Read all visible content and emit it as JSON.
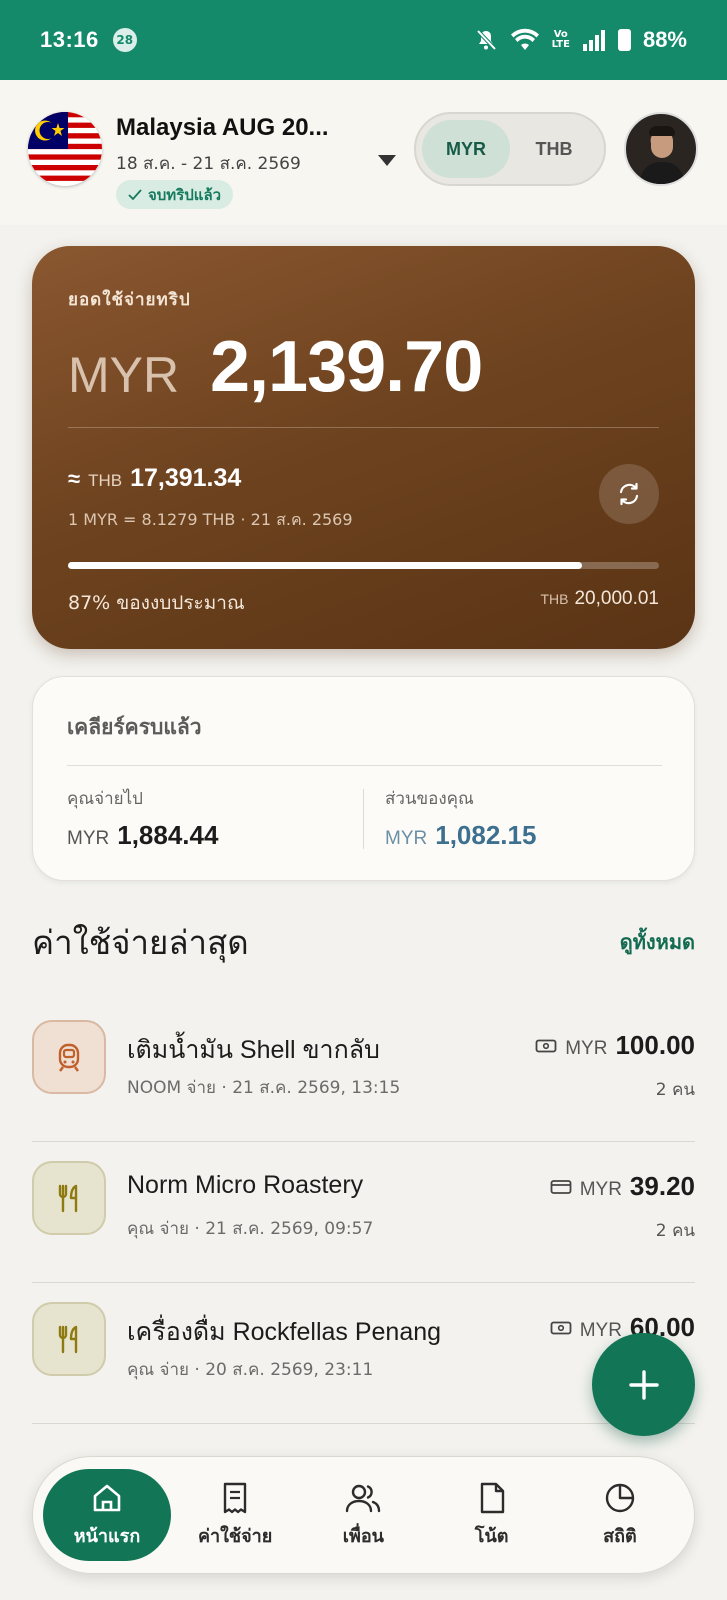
{
  "status_bar": {
    "time": "13:16",
    "notification_count": "28",
    "network_label": "Vo LTE",
    "battery": "88%"
  },
  "header": {
    "trip_title": "Malaysia AUG 20...",
    "trip_dates": "18 ส.ค. - 21 ส.ค. 2569",
    "trip_status": "จบทริปแล้ว",
    "currency_options": [
      "MYR",
      "THB"
    ],
    "active_currency": "MYR"
  },
  "spending": {
    "label": "ยอดใช้จ่ายทริป",
    "currency": "MYR",
    "amount": "2,139.70",
    "approx_symbol": "≈",
    "approx_currency": "THB",
    "approx_amount": "17,391.34",
    "rate_text": "1 MYR = 8.1279 THB · 21 ส.ค. 2569",
    "budget_progress": 0.87,
    "budget_percent_text": "87% ของงบประมาณ",
    "budget_currency": "THB",
    "budget_amount": "20,000.01"
  },
  "settlement": {
    "title": "เคลียร์ครบแล้ว",
    "you_paid_label": "คุณจ่ายไป",
    "you_paid_currency": "MYR",
    "you_paid_amount": "1,884.44",
    "your_share_label": "ส่วนของคุณ",
    "your_share_currency": "MYR",
    "your_share_amount": "1,082.15"
  },
  "recent": {
    "title": "ค่าใช้จ่ายล่าสุด",
    "see_all": "ดูทั้งหมด",
    "items": [
      {
        "name": "เติมน้ำมัน Shell ขากลับ",
        "meta": "NOOM จ่าย  ·  21 ส.ค. 2569, 13:15",
        "currency": "MYR",
        "amount": "100.00",
        "people": "2 คน",
        "icon": "fuel-icon",
        "payment": "cash-icon"
      },
      {
        "name": "Norm Micro Roastery",
        "meta": "คุณ จ่าย  ·  21 ส.ค. 2569, 09:57",
        "currency": "MYR",
        "amount": "39.20",
        "people": "2 คน",
        "icon": "food-icon",
        "payment": "card-icon"
      },
      {
        "name": "เครื่องดื่ม Rockfellas Penang",
        "meta": "คุณ จ่าย  ·  20 ส.ค. 2569, 23:11",
        "currency": "MYR",
        "amount": "60.00",
        "people": "",
        "icon": "food-icon",
        "payment": "cash-icon"
      }
    ]
  },
  "bottom_nav": {
    "items": [
      {
        "label": "หน้าแรก",
        "icon": "home-icon",
        "active": true
      },
      {
        "label": "ค่าใช้จ่าย",
        "icon": "receipt-icon",
        "active": false
      },
      {
        "label": "เพื่อน",
        "icon": "friends-icon",
        "active": false
      },
      {
        "label": "โน้ต",
        "icon": "note-icon",
        "active": false
      },
      {
        "label": "สถิติ",
        "icon": "stats-icon",
        "active": false
      }
    ]
  },
  "colors": {
    "brand_green": "#148a6b",
    "card_brown": "#6e431f",
    "share_blue": "#3d6f8f"
  }
}
